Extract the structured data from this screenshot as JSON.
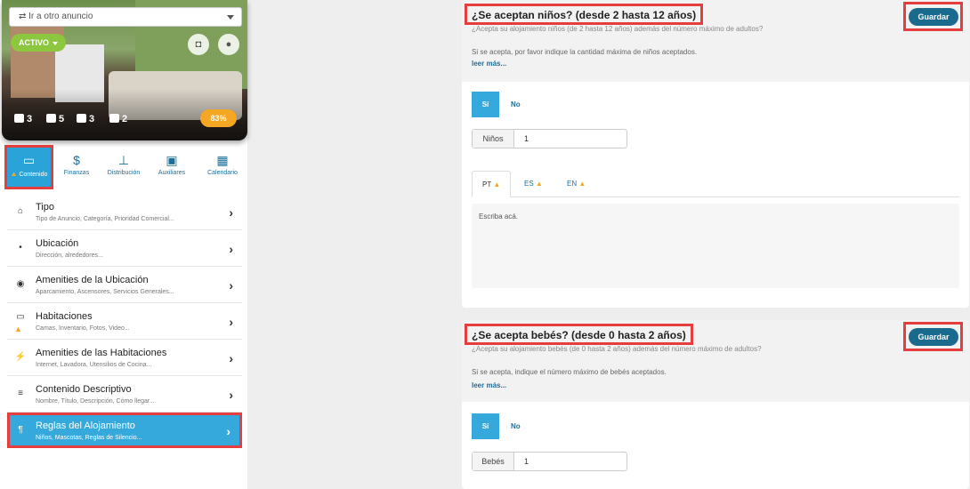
{
  "sidebar": {
    "listing_select": "⇄ Ir a otro anuncio",
    "status_label": "ACTIVO",
    "stats": {
      "rooms": "3",
      "guests": "5",
      "beds": "3",
      "baths": "2"
    },
    "completion": "83%",
    "tabs": [
      {
        "label": "Contenido",
        "icon": "bed-icon",
        "warning": true
      },
      {
        "label": "Finanzas",
        "icon": "dollar-icon"
      },
      {
        "label": "Distribución",
        "icon": "sitemap-icon"
      },
      {
        "label": "Auxiliares",
        "icon": "cubes-icon"
      },
      {
        "label": "Calendario",
        "icon": "calendar-icon"
      }
    ],
    "menu": [
      {
        "title": "Tipo",
        "subtitle": "Tipo de Anuncio, Categoría, Prioridad Comercial...",
        "icon": "home-icon"
      },
      {
        "title": "Ubicación",
        "subtitle": "Dirección, alrededores...",
        "icon": "map-pin-icon"
      },
      {
        "title": "Amenities de la Ubicación",
        "subtitle": "Aparcamiento, Ascensores, Servicios Generales...",
        "icon": "dot-circle-icon"
      },
      {
        "title": "Habitaciones",
        "subtitle": "Camas, Inventario, Fotos, Video...",
        "icon": "bed-icon",
        "warning": true
      },
      {
        "title": "Amenities de las Habitaciones",
        "subtitle": "Internet, Lavadora, Utensilios de Cocina...",
        "icon": "plug-icon"
      },
      {
        "title": "Contenido Descriptivo",
        "subtitle": "Nombre, Título, Descripción, Cómo llegar...",
        "icon": "align-left-icon"
      },
      {
        "title": "Reglas del Alojamiento",
        "subtitle": "Niños, Mascotas, Reglas de Silencio...",
        "icon": "paragraph-icon",
        "active": true
      }
    ]
  },
  "children_card": {
    "title": "¿Se aceptan niños? (desde 2 hasta 12 años)",
    "desc1": "¿Acepta su alojamiento niños (de 2 hasta 12 años) además del número máximo de adultos?",
    "desc2": "Si se acepta, por favor indique la cantidad máxima de niños aceptados.",
    "read_more": "leer más...",
    "save": "Guardar",
    "yes": "Sí",
    "no": "No",
    "field_label": "Niños",
    "field_value": "1",
    "lang_tabs": [
      "PT",
      "ES",
      "EN"
    ],
    "textarea_placeholder": "Escriba acá."
  },
  "babies_card": {
    "title": "¿Se acepta bebés? (desde 0 hasta 2 años)",
    "desc1": "¿Acepta su alojamiento bebés (de 0 hasta 2 años) además del número máximo de adultos?",
    "desc2": "Si se acepta, indique el número máximo de bebés aceptados.",
    "read_more": "leer más...",
    "save": "Guardar",
    "yes": "Sí",
    "no": "No",
    "field_label": "Bebés",
    "field_value": "1"
  },
  "colors": {
    "accent": "#36a9dc",
    "save": "#1a6a8e",
    "active_status": "#8dc63f",
    "warning": "#f5a623",
    "highlight": "#e53e3e"
  }
}
